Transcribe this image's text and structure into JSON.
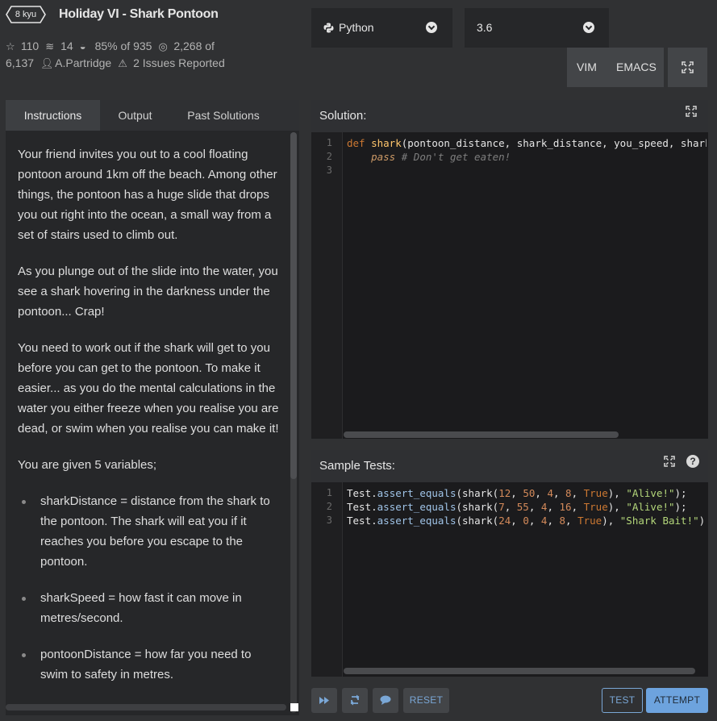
{
  "header": {
    "rank": "8 kyu",
    "title": "Holiday VI - Shark Pontoon",
    "stars": "110",
    "collections": "14",
    "satisfaction_pct": "85%",
    "satisfaction_of": "of 935",
    "completed": "2,268",
    "completed_of": "of",
    "completed_total": "6,137",
    "author": "A.Partridge",
    "issues": "2 Issues Reported"
  },
  "language_select": {
    "value": "Python"
  },
  "version_select": {
    "value": "3.6"
  },
  "keybindings": {
    "vim": "VIM",
    "emacs": "EMACS"
  },
  "tabs": [
    {
      "label": "Instructions",
      "active": true
    },
    {
      "label": "Output",
      "active": false
    },
    {
      "label": "Past Solutions",
      "active": false
    }
  ],
  "instructions": {
    "paragraphs": [
      "Your friend invites you out to a cool floating pontoon around 1km off the beach. Among other things, the pontoon has a huge slide that drops you out right into the ocean, a small way from a set of stairs used to climb out.",
      "As you plunge out of the slide into the water, you see a shark hovering in the darkness under the pontoon... Crap!",
      "You need to work out if the shark will get to you before you can get to the pontoon. To make it easier... as you do the mental calculations in the water you either freeze when you realise you are dead, or swim when you realise you can make it!",
      "You are given 5 variables;"
    ],
    "bullets": [
      "sharkDistance = distance from the shark to the pontoon. The shark will eat you if it reaches you before you escape to the pontoon.",
      "sharkSpeed = how fast it can move in metres/second.",
      "pontoonDistance = how far you need to swim to safety in metres."
    ]
  },
  "solution": {
    "title": "Solution:",
    "line_numbers": [
      "1",
      "2",
      "3"
    ],
    "code": {
      "def_kw": "def",
      "fn_name": "shark",
      "params": "(pontoon_distance, shark_distance, you_speed, shark_speed, dolphin):",
      "pass_kw": "pass",
      "comment": "# Don't get eaten!"
    }
  },
  "sample_tests": {
    "title": "Sample Tests:",
    "line_numbers": [
      "1",
      "2",
      "3"
    ],
    "lines": [
      {
        "obj": "Test",
        "method": "assert_equals",
        "fn": "shark",
        "args": [
          "12",
          "50",
          "4",
          "8"
        ],
        "flag": "True",
        "expected": "\"Alive!\""
      },
      {
        "obj": "Test",
        "method": "assert_equals",
        "fn": "shark",
        "args": [
          "7",
          "55",
          "4",
          "16"
        ],
        "flag": "True",
        "expected": "\"Alive!\""
      },
      {
        "obj": "Test",
        "method": "assert_equals",
        "fn": "shark",
        "args": [
          "24",
          "0",
          "4",
          "8"
        ],
        "flag": "True",
        "expected": "\"Shark Bait!\""
      }
    ]
  },
  "actions": {
    "reset": "RESET",
    "test": "TEST",
    "attempt": "ATTEMPT"
  },
  "colors": {
    "background": "#303133",
    "panel": "#262729",
    "editor": "#1b1b1d",
    "attempt_blue": "#6da3de",
    "test_border": "#7aa7d6"
  },
  "icons": [
    "rank-badge-icon",
    "star-icon",
    "collection-icon",
    "eye-icon",
    "target-icon",
    "user-icon",
    "warning-icon",
    "python-icon",
    "chevron-down-icon",
    "fullscreen-icon",
    "expand-icon",
    "help-icon",
    "fast-forward-icon",
    "refresh-icon",
    "chat-icon"
  ]
}
